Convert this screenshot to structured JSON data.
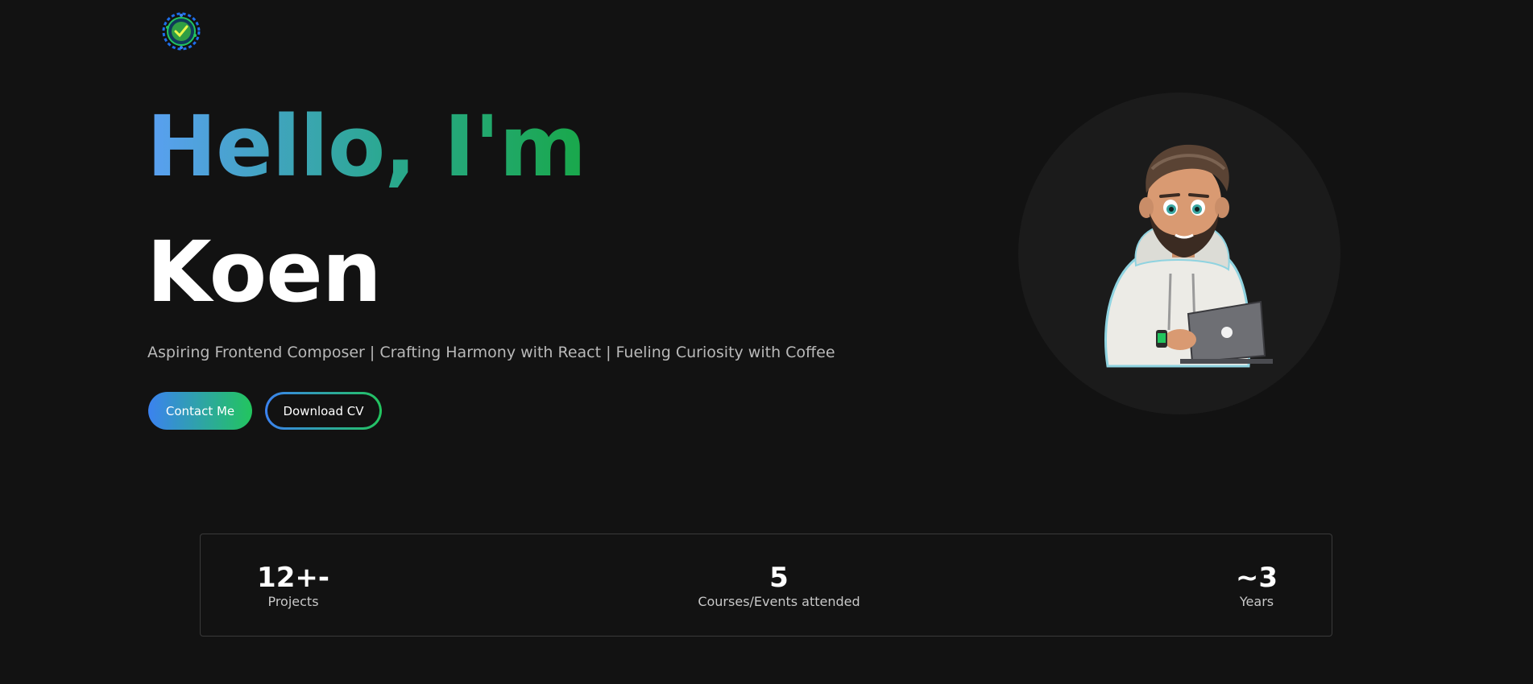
{
  "header": {
    "logo_icon": "globe-logo-icon"
  },
  "hero": {
    "greeting": "Hello, I'm",
    "name": "Koen",
    "tagline": "Aspiring Frontend Composer | Crafting Harmony with React | Fueling Curiosity with Coffee",
    "contact_label": "Contact Me",
    "download_label": "Download CV",
    "avatar_icon": "developer-avatar-icon"
  },
  "stats": {
    "items": [
      {
        "value": "12+-",
        "label": "Projects"
      },
      {
        "value": "5",
        "label": "Courses/Events attended"
      },
      {
        "value": "~3",
        "label": "Years"
      }
    ]
  },
  "colors": {
    "background": "#121212",
    "gradient_start": "#3b82f0",
    "gradient_end": "#22c55e",
    "muted_text": "#b9b9b9"
  }
}
